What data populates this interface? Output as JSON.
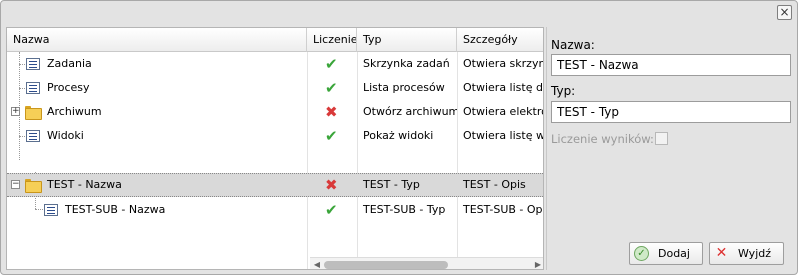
{
  "grid": {
    "columns": {
      "name": "Nazwa",
      "count": "Liczenie",
      "type": "Typ",
      "details": "Szczegóły"
    },
    "rows": [
      {
        "name": "Zadania",
        "icon": "leaf",
        "count": "yes",
        "type": "Skrzynka zadań",
        "details": "Otwiera skrzynk"
      },
      {
        "name": "Procesy",
        "icon": "leaf",
        "count": "yes",
        "type": "Lista procesów",
        "details": "Otwiera listę do"
      },
      {
        "name": "Archiwum",
        "icon": "folder",
        "count": "no",
        "type": "Otwórz archiwum",
        "details": "Otwiera elektron"
      },
      {
        "name": "Widoki",
        "icon": "leaf",
        "count": "yes",
        "type": "Pokaż widoki",
        "details": "Otwiera listę ws"
      },
      {
        "name": "TEST - Nazwa",
        "icon": "folder-open",
        "count": "no",
        "type": "TEST - Typ",
        "details": "TEST - Opis"
      },
      {
        "name": "TEST-SUB - Nazwa",
        "icon": "leaf",
        "count": "yes",
        "type": "TEST-SUB - Typ",
        "details": "TEST-SUB - Opis"
      }
    ]
  },
  "form": {
    "name_label": "Nazwa:",
    "name_value": "TEST - Nazwa",
    "type_label": "Typ:",
    "type_value": "TEST - Typ",
    "count_label": "Liczenie wyników:",
    "count_checked": false
  },
  "buttons": {
    "add": "Dodaj",
    "exit": "Wyjdź"
  },
  "window": {
    "close": "×"
  },
  "colors": {
    "check": "#3aa53a",
    "cross": "#d93a3a",
    "selected_row": "#d9d9d9",
    "panel_bg": "#e3e3e3"
  }
}
